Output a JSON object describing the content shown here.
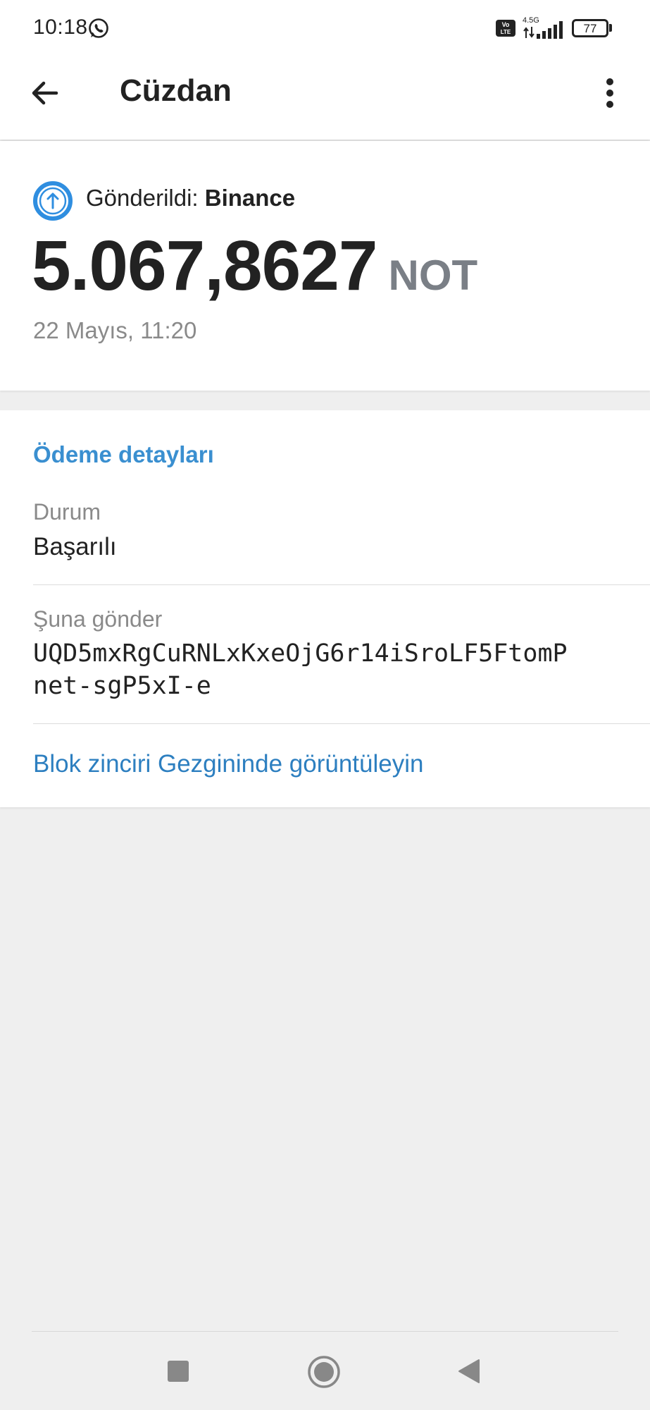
{
  "status_bar": {
    "time": "10:18",
    "network": "4.5G",
    "volte": "Vo LTE",
    "battery": "77",
    "icons": [
      "whatsapp-icon",
      "volte-icon",
      "signal-icon",
      "battery-icon"
    ]
  },
  "app_bar": {
    "title": "Cüzdan",
    "back_icon": "arrow-left-icon",
    "more_icon": "more-vert-icon"
  },
  "transaction": {
    "direction_label": "Gönderildi:",
    "counterparty": "Binance",
    "amount": "5.067,8627",
    "currency": "NOT",
    "date": "22 Mayıs, 11:20",
    "icon": "arrow-up-circle-icon"
  },
  "details": {
    "title": "Ödeme detayları",
    "status_label": "Durum",
    "status_value": "Başarılı",
    "recipient_label": "Şuna gönder",
    "recipient_address_line1": "UQD5mxRgCuRNLxKxeOjG6r14iSroLF5FtomP",
    "recipient_address_line2": "net-sgP5xI-e",
    "explorer_link": "Blok zinciri Gezgininde görüntüleyin"
  },
  "navigation": {
    "icons": [
      "recent-apps-icon",
      "home-icon",
      "back-triangle-icon"
    ]
  },
  "colors": {
    "accent": "#3a8fd0",
    "link": "#2d7fc0",
    "icon_blue": "#2f8ee0",
    "background": "#efefef",
    "currency_gray": "#7a7f86"
  }
}
